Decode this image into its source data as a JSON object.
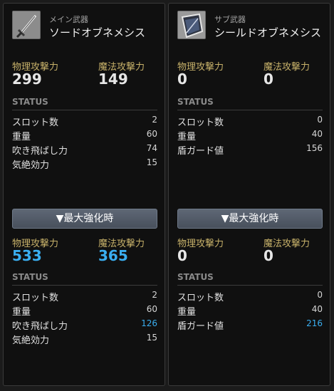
{
  "panels": [
    {
      "category": "メイン武器",
      "name": "ソードオブネメシス",
      "icon": "sword-icon",
      "base": {
        "attack_labels": [
          "物理攻撃力",
          "魔法攻撃力"
        ],
        "attack_values": [
          "299",
          "149"
        ],
        "status_label": "STATUS",
        "stats": [
          {
            "label": "スロット数",
            "value": "2"
          },
          {
            "label": "重量",
            "value": "60"
          },
          {
            "label": "吹き飛ばし力",
            "value": "74"
          },
          {
            "label": "気絶効力",
            "value": "15"
          }
        ]
      },
      "max_button": "▼最大強化時",
      "max": {
        "attack_labels": [
          "物理攻撃力",
          "魔法攻撃力"
        ],
        "attack_values": [
          "533",
          "365"
        ],
        "status_label": "STATUS",
        "stats": [
          {
            "label": "スロット数",
            "value": "2"
          },
          {
            "label": "重量",
            "value": "60"
          },
          {
            "label": "吹き飛ばし力",
            "value": "126"
          },
          {
            "label": "気絶効力",
            "value": "15"
          }
        ]
      }
    },
    {
      "category": "サブ武器",
      "name": "シールドオブネメシス",
      "icon": "shield-icon",
      "base": {
        "attack_labels": [
          "物理攻撃力",
          "魔法攻撃力"
        ],
        "attack_values": [
          "0",
          "0"
        ],
        "status_label": "STATUS",
        "stats": [
          {
            "label": "スロット数",
            "value": "0"
          },
          {
            "label": "重量",
            "value": "40"
          },
          {
            "label": "盾ガード値",
            "value": "156"
          }
        ]
      },
      "max_button": "▼最大強化時",
      "max": {
        "attack_labels": [
          "物理攻撃力",
          "魔法攻撃力"
        ],
        "attack_values": [
          "0",
          "0"
        ],
        "status_label": "STATUS",
        "stats": [
          {
            "label": "スロット数",
            "value": "0"
          },
          {
            "label": "重量",
            "value": "40"
          },
          {
            "label": "盾ガード値",
            "value": "216"
          }
        ]
      }
    }
  ],
  "colors": {
    "attack_label": "#c8b26a",
    "enhanced_value": "#3aaef0",
    "button": "#535b67"
  }
}
